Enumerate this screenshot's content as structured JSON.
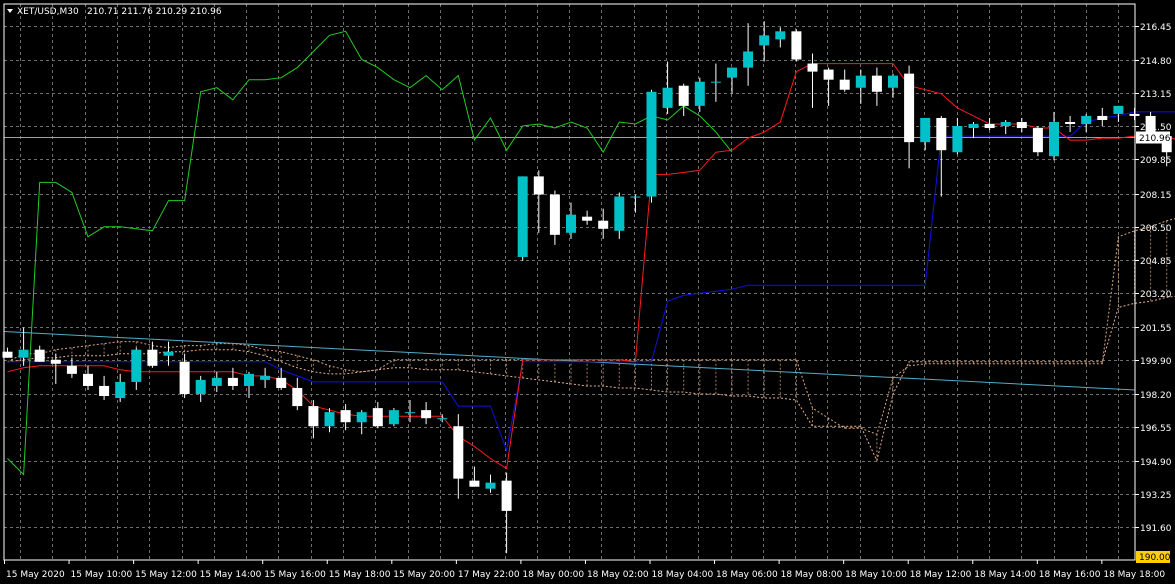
{
  "header": {
    "symbol_label": "XET/USD,M30",
    "ohlc_label": "210.71 211.76 210.29 210.96",
    "arrow_icon": "triangle-down-icon"
  },
  "price_tags": {
    "current": "210.96",
    "min": "190.00"
  },
  "colors": {
    "background": "#000000",
    "grid": "#6e6e6e",
    "bull_candle": "#00c0c8",
    "bear_candle": "#ffffff",
    "tenkan": "#ff1a1a",
    "kijun": "#1010e0",
    "chikou": "#22cc22",
    "span_a": "#d9a77a",
    "span_b": "#e8b090",
    "trend_line": "#4fb0c6",
    "current_price_line": "#a0a0a0"
  },
  "chart_data": {
    "type": "candlestick",
    "symbol": "XET/USD",
    "timeframe": "M30",
    "ylim": [
      190.0,
      217.3
    ],
    "y_ticks": [
      216.45,
      214.8,
      213.15,
      211.5,
      209.85,
      208.15,
      206.5,
      204.85,
      203.2,
      201.55,
      199.9,
      198.2,
      196.55,
      194.9,
      193.25,
      191.6
    ],
    "x_tick_labels": [
      "15 May 2020",
      "15 May 10:00",
      "15 May 12:00",
      "15 May 14:00",
      "15 May 16:00",
      "15 May 18:00",
      "15 May 20:00",
      "17 May 22:00",
      "18 May 00:00",
      "18 May 02:00",
      "18 May 04:00",
      "18 May 06:00",
      "18 May 08:00",
      "18 May 10:00",
      "18 May 12:00",
      "18 May 14:00",
      "18 May 16:00",
      "18 May 18:00"
    ],
    "candles": [
      [
        200.3,
        200.5,
        200.0,
        200.0
      ],
      [
        200.0,
        201.5,
        199.6,
        200.4
      ],
      [
        200.4,
        200.6,
        199.8,
        199.8
      ],
      [
        199.9,
        200.2,
        198.7,
        199.7
      ],
      [
        199.6,
        200.0,
        199.0,
        199.2
      ],
      [
        199.2,
        199.6,
        198.4,
        198.6
      ],
      [
        198.6,
        199.1,
        197.9,
        198.1
      ],
      [
        198.0,
        199.2,
        197.8,
        198.8
      ],
      [
        198.8,
        200.5,
        198.4,
        200.4
      ],
      [
        200.4,
        200.8,
        199.5,
        199.6
      ],
      [
        200.1,
        200.8,
        199.6,
        200.3
      ],
      [
        199.8,
        200.2,
        198.0,
        198.2
      ],
      [
        198.2,
        199.1,
        197.8,
        198.9
      ],
      [
        198.6,
        199.3,
        198.3,
        199.0
      ],
      [
        199.0,
        199.5,
        198.4,
        198.6
      ],
      [
        198.6,
        199.3,
        198.0,
        199.2
      ],
      [
        198.9,
        199.5,
        198.5,
        199.1
      ],
      [
        199.0,
        199.5,
        198.4,
        198.5
      ],
      [
        198.5,
        199.0,
        197.4,
        197.6
      ],
      [
        197.6,
        197.9,
        196.0,
        196.6
      ],
      [
        196.6,
        197.5,
        196.3,
        197.3
      ],
      [
        197.4,
        197.7,
        196.4,
        196.8
      ],
      [
        196.8,
        197.4,
        196.2,
        197.3
      ],
      [
        197.5,
        197.8,
        196.5,
        196.6
      ],
      [
        196.7,
        197.5,
        196.6,
        197.4
      ],
      [
        197.3,
        197.9,
        196.8,
        197.3
      ],
      [
        197.4,
        197.8,
        196.7,
        197.0
      ],
      [
        197.0,
        197.2,
        196.8,
        197.0
      ],
      [
        196.6,
        197.2,
        193.0,
        194.0
      ],
      [
        193.9,
        194.6,
        193.6,
        193.6
      ],
      [
        193.5,
        194.2,
        193.3,
        193.8
      ],
      [
        193.9,
        194.3,
        190.3,
        192.4
      ],
      [
        205.0,
        209.0,
        204.8,
        209.0
      ],
      [
        209.0,
        209.3,
        206.2,
        208.1
      ],
      [
        208.1,
        208.3,
        205.6,
        206.1
      ],
      [
        206.2,
        207.7,
        205.9,
        207.1
      ],
      [
        207.0,
        207.3,
        206.6,
        206.8
      ],
      [
        206.8,
        207.4,
        205.9,
        206.4
      ],
      [
        206.3,
        208.2,
        205.9,
        208.0
      ],
      [
        208.0,
        208.1,
        207.2,
        208.0
      ],
      [
        208.0,
        213.3,
        207.7,
        213.2
      ],
      [
        212.4,
        214.7,
        212.1,
        213.4
      ],
      [
        213.5,
        213.6,
        212.0,
        212.5
      ],
      [
        212.5,
        213.9,
        212.2,
        213.7
      ],
      [
        213.7,
        214.6,
        212.7,
        213.7
      ],
      [
        213.9,
        214.4,
        213.1,
        214.4
      ],
      [
        214.4,
        216.6,
        213.5,
        215.2
      ],
      [
        215.5,
        216.7,
        214.7,
        216.0
      ],
      [
        215.8,
        216.4,
        215.4,
        216.2
      ],
      [
        216.2,
        216.3,
        214.7,
        214.8
      ],
      [
        214.6,
        215.1,
        212.4,
        214.2
      ],
      [
        214.3,
        214.4,
        212.5,
        213.8
      ],
      [
        213.8,
        214.3,
        213.2,
        213.3
      ],
      [
        213.4,
        214.3,
        212.6,
        214.0
      ],
      [
        214.0,
        214.4,
        212.5,
        213.2
      ],
      [
        213.4,
        214.1,
        212.9,
        214.0
      ],
      [
        214.1,
        214.5,
        209.4,
        210.7
      ],
      [
        210.7,
        211.9,
        210.3,
        211.9
      ],
      [
        211.9,
        212.0,
        208.0,
        210.3
      ],
      [
        210.2,
        211.9,
        210.1,
        211.5
      ],
      [
        211.4,
        211.7,
        210.9,
        211.6
      ],
      [
        211.6,
        211.9,
        211.3,
        211.4
      ],
      [
        211.5,
        211.8,
        211.1,
        211.7
      ],
      [
        211.7,
        211.9,
        211.2,
        211.4
      ],
      [
        211.4,
        211.5,
        210.0,
        210.2
      ],
      [
        210.0,
        212.2,
        209.8,
        211.7
      ],
      [
        211.7,
        212.0,
        211.2,
        211.6
      ],
      [
        211.6,
        212.1,
        211.2,
        212.0
      ],
      [
        212.0,
        212.4,
        211.5,
        211.8
      ],
      [
        212.1,
        212.5,
        211.7,
        212.5
      ],
      [
        212.1,
        212.4,
        211.8,
        212.0
      ],
      [
        212.0,
        212.2,
        210.9,
        211.2
      ],
      [
        211.0,
        211.2,
        209.5,
        210.2
      ],
      [
        210.5,
        210.9,
        208.6,
        208.9
      ],
      [
        209.0,
        211.2,
        208.4,
        210.6
      ],
      [
        210.6,
        211.4,
        210.6,
        210.96
      ]
    ],
    "tenkan_sen": [
      199.3,
      199.5,
      199.6,
      199.6,
      199.6,
      199.6,
      199.6,
      199.4,
      199.3,
      199.3,
      199.3,
      199.3,
      199.3,
      199.3,
      199.3,
      199.1,
      199.1,
      198.9,
      198.4,
      197.6,
      197.4,
      197.2,
      197.1,
      197.1,
      197.1,
      197.1,
      197.1,
      197.1,
      196.1,
      195.6,
      195.0,
      194.5,
      199.9,
      199.9,
      199.9,
      199.9,
      199.9,
      199.9,
      199.9,
      199.8,
      209.1,
      209.1,
      209.2,
      209.3,
      210.2,
      210.3,
      210.9,
      211.2,
      211.7,
      214.2,
      214.6,
      214.6,
      214.6,
      214.6,
      214.6,
      214.6,
      213.5,
      213.3,
      213.1,
      212.4,
      212.0,
      211.6,
      211.6,
      211.6,
      211.4,
      211.4,
      210.8,
      210.8,
      210.9,
      210.9,
      211.0,
      211.0,
      211.0,
      210.7,
      210.6,
      210.5
    ],
    "kijun_sen": [
      199.8,
      199.8,
      199.8,
      199.8,
      199.8,
      199.8,
      199.8,
      199.8,
      199.8,
      199.8,
      199.8,
      199.8,
      199.8,
      199.8,
      199.8,
      199.8,
      199.8,
      199.4,
      199.1,
      198.8,
      198.8,
      198.8,
      198.8,
      198.8,
      198.8,
      198.8,
      198.8,
      198.8,
      197.6,
      197.6,
      197.6,
      195.4,
      199.8,
      199.8,
      199.8,
      199.8,
      199.8,
      199.8,
      199.8,
      199.8,
      199.8,
      202.8,
      203.1,
      203.2,
      203.3,
      203.4,
      203.6,
      203.6,
      203.6,
      203.6,
      203.6,
      203.6,
      203.6,
      203.6,
      203.6,
      203.6,
      203.6,
      203.6,
      211.0,
      211.0,
      211.0,
      211.0,
      211.0,
      211.0,
      211.0,
      211.0,
      211.0,
      211.7,
      211.9,
      212.0,
      212.2,
      212.2,
      212.2,
      212.2,
      212.2,
      212.2
    ],
    "chikou_span": [
      195.0,
      194.2,
      208.7,
      208.7,
      208.2,
      206.0,
      206.5,
      206.5,
      206.4,
      206.3,
      207.8,
      207.8,
      213.2,
      213.4,
      212.8,
      213.8,
      213.8,
      213.9,
      214.4,
      215.2,
      216.0,
      216.2,
      214.8,
      214.4,
      213.8,
      213.4,
      214.0,
      213.3,
      214.0,
      210.8,
      211.9,
      210.3,
      211.5,
      211.6,
      211.4,
      211.7,
      211.4,
      210.2,
      211.7,
      211.6,
      212.0,
      211.8,
      212.5,
      212.0,
      211.2,
      210.2
    ],
    "senkou_span_a": [
      199.8,
      200.2,
      200.2,
      200.4,
      200.5,
      200.6,
      200.7,
      200.8,
      200.8,
      200.6,
      200.5,
      200.6,
      200.6,
      200.7,
      200.7,
      200.6,
      200.4,
      200.3,
      200.1,
      199.9,
      199.6,
      199.4,
      199.3,
      199.4,
      199.9,
      199.9,
      199.9,
      199.9,
      199.9,
      199.9,
      199.9,
      199.9,
      199.9,
      199.9,
      199.9,
      199.9,
      199.9,
      199.9,
      199.9,
      199.9,
      199.9,
      199.9,
      199.9,
      199.9,
      199.9,
      199.9,
      199.9,
      199.9,
      199.9,
      199.9,
      197.5,
      197.0,
      196.5,
      196.5,
      196.2,
      199.0,
      199.6,
      199.7,
      199.7,
      199.7,
      199.7,
      199.7,
      199.7,
      199.7,
      199.7,
      199.7,
      199.7,
      199.7,
      199.7,
      206.0,
      206.3,
      206.5,
      206.8,
      207.0,
      207.1,
      207.3,
      207.7,
      207.9,
      207.9
    ],
    "senkou_span_b": [
      199.8,
      199.9,
      200.0,
      200.0,
      200.1,
      200.1,
      200.1,
      200.2,
      200.2,
      200.2,
      200.3,
      200.3,
      200.4,
      200.4,
      200.4,
      200.3,
      200.1,
      199.8,
      199.5,
      199.3,
      199.2,
      199.2,
      199.3,
      199.4,
      199.5,
      199.5,
      199.4,
      199.4,
      199.4,
      199.3,
      199.2,
      199.1,
      199.0,
      198.9,
      198.8,
      198.7,
      198.6,
      198.6,
      198.5,
      198.5,
      198.4,
      198.3,
      198.3,
      198.2,
      198.2,
      198.1,
      198.1,
      198.0,
      198.0,
      197.9,
      196.6,
      196.6,
      196.6,
      196.6,
      194.9,
      198.2,
      199.8,
      199.8,
      199.8,
      199.8,
      199.8,
      199.8,
      199.8,
      199.8,
      199.8,
      199.8,
      199.8,
      199.8,
      199.8,
      202.5,
      202.7,
      202.8,
      203.0,
      203.1,
      203.2,
      203.3,
      203.5,
      203.7,
      203.6
    ],
    "trend_line": {
      "from": [
        0,
        201.3
      ],
      "to": [
        82,
        198.4
      ]
    },
    "current_price": 210.96
  }
}
